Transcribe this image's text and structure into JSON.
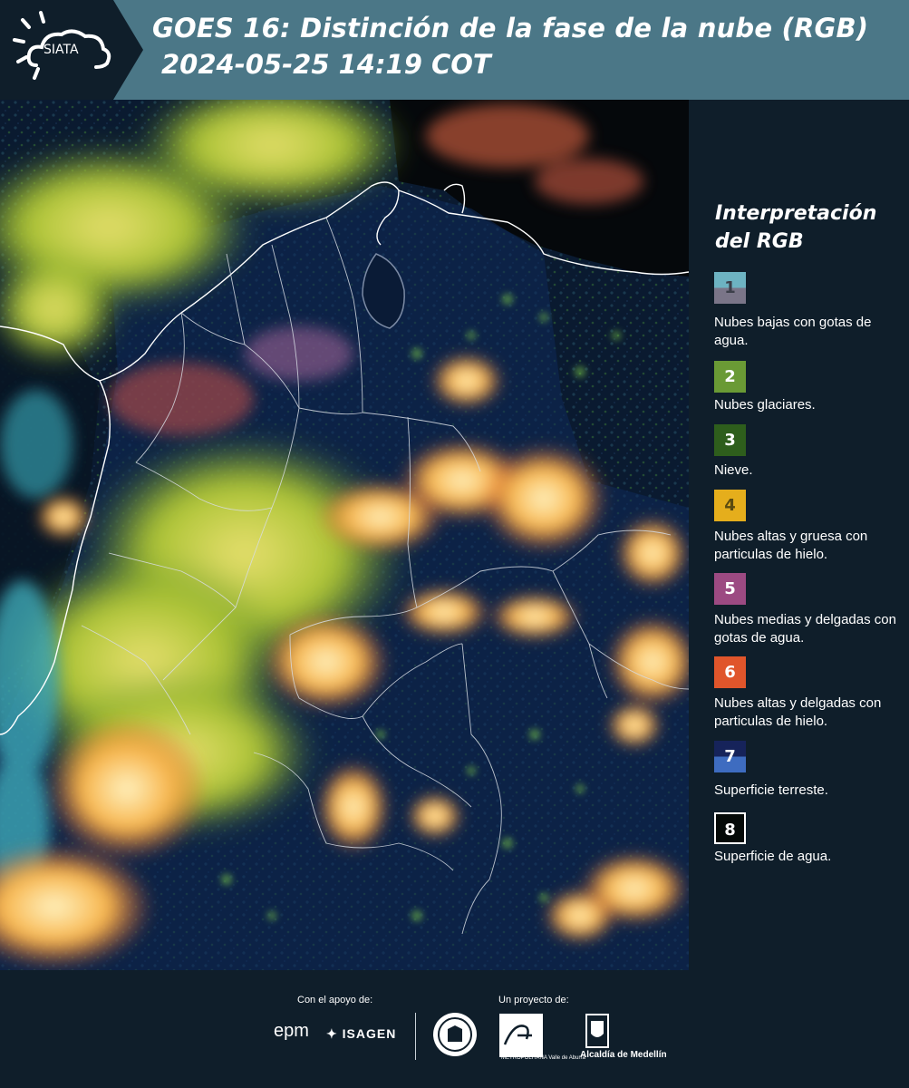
{
  "header": {
    "logo_text": "SIATA",
    "title_line1": "GOES 16: Distinción de la fase de la nube (RGB)",
    "title_line2": "2024-05-25 14:19 COT"
  },
  "legend": {
    "title_line1": "Interpretación",
    "title_line2": "del RGB",
    "items": [
      {
        "number": "1",
        "label": "Nubes bajas con gotas de agua.",
        "color_top": "#6db3c2",
        "color_bottom": "#7a7588",
        "text_color": "#3c3f4a"
      },
      {
        "number": "2",
        "label": "Nubes glaciares.",
        "color_top": "#6a9a35",
        "color_bottom": "#6a9a35",
        "text_color": "#ffffff"
      },
      {
        "number": "3",
        "label": "Nieve.",
        "color_top": "#2e5e1c",
        "color_bottom": "#2e5e1c",
        "text_color": "#ffffff"
      },
      {
        "number": "4",
        "label": "Nubes altas y gruesa con particulas de hielo.",
        "color_top": "#e5ae1c",
        "color_bottom": "#e5ae1c",
        "text_color": "#5a4a10"
      },
      {
        "number": "5",
        "label": "Nubes medias y delgadas con gotas de agua.",
        "color_top": "#9c4a82",
        "color_bottom": "#9c4a82",
        "text_color": "#ffffff"
      },
      {
        "number": "6",
        "label": "Nubes altas y delgadas con particulas de hielo.",
        "color_top": "#e0552b",
        "color_bottom": "#e0552b",
        "text_color": "#ffffff"
      },
      {
        "number": "7",
        "label": "Superficie terreste.",
        "color_top": "#16235a",
        "color_bottom": "#3e6cc0",
        "text_color": "#ffffff"
      },
      {
        "number": "8",
        "label": "Superficie de agua.",
        "color_top": "#050a08",
        "color_bottom": "#050a08",
        "text_color": "#ffffff"
      }
    ]
  },
  "footer": {
    "support_label": "Con el apoyo de:",
    "project_label": "Un proyecto de:",
    "sponsor_1": "epm",
    "sponsor_2": "ISAGEN",
    "partner_area": "METROPOLITANA Valle de Aburrá",
    "partner_alcaldia": "Alcaldía de Medellín"
  },
  "colors": {
    "header_bg": "#4b7787",
    "logo_bg": "#0f1e2a",
    "page_bg": "#0f1e2a",
    "cloud_high": "#f5b64a",
    "cloud_glacial": "#b8c93a",
    "land_surface": "#16306a",
    "boundaries": "#ffffff"
  }
}
